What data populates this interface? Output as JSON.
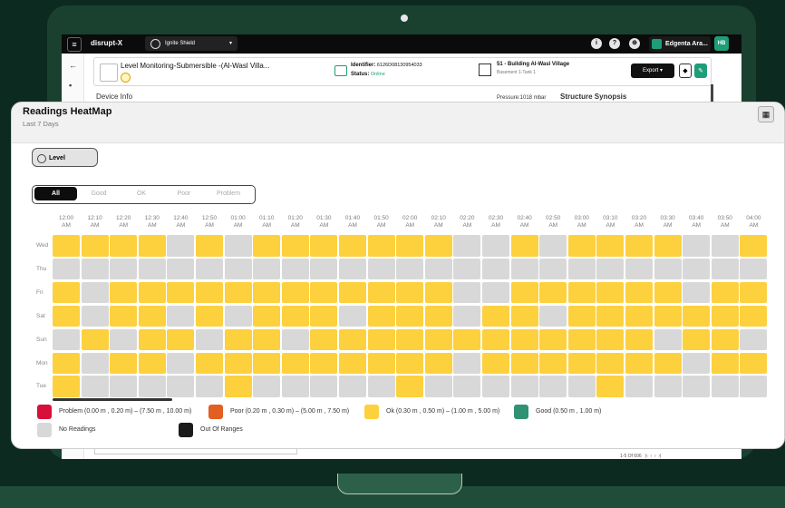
{
  "app": {
    "logo_text": "disrupt-X",
    "workspace": "Ignite Shield",
    "user": "Edgenta Ara...",
    "avatar": "HB",
    "top_icons": [
      "info-icon",
      "help-icon",
      "globe-icon"
    ]
  },
  "device": {
    "title": "Level Monitoring-Submersible -(Al-Wasl Villa...",
    "identifier_label": "Identifier:",
    "identifier": "6126D08130954033",
    "status_label": "Status:",
    "status": "Online",
    "building": "51 - Building Al-Wasl Village",
    "location": "Basement 1-Tank 1",
    "export_label": "Export"
  },
  "background_peek": {
    "device_info": "Device Info",
    "pressure": "Pressure:1018 mbar",
    "structure": "Structure Synopsis",
    "pager": "1-5 Of 606"
  },
  "heatmap": {
    "title": "Readings HeatMap",
    "subtitle": "Last 7 Days",
    "level_label": "Level",
    "filters": [
      "All",
      "Good",
      "OK",
      "Poor",
      "Problem"
    ],
    "active_filter": "All",
    "times": [
      "12:00 AM",
      "12:10 AM",
      "12:20 AM",
      "12:30 AM",
      "12:40 AM",
      "12:50 AM",
      "01:00 AM",
      "01:10 AM",
      "01:20 AM",
      "01:30 AM",
      "01:40 AM",
      "01:50 AM",
      "02:00 AM",
      "02:10 AM",
      "02:20 AM",
      "02:30 AM",
      "02:40 AM",
      "02:50 AM",
      "03:00 AM",
      "03:10 AM",
      "03:20 AM",
      "03:30 AM",
      "03:40 AM",
      "03:50 AM",
      "04:00 AM"
    ],
    "days": [
      "Wed",
      "Thu",
      "Fri",
      "Sat",
      "Sun",
      "Mon",
      "Tue"
    ],
    "status_colors": {
      "problem": "#d80f38",
      "poor": "#e35e22",
      "ok": "#fdd03d",
      "good": "#2e9273",
      "none": "#d8d8d8",
      "out_of_range": "#1b1b1b"
    },
    "grid": [
      [
        "ok",
        "ok",
        "ok",
        "ok",
        "none",
        "ok",
        "none",
        "ok",
        "ok",
        "ok",
        "ok",
        "ok",
        "ok",
        "ok",
        "none",
        "none",
        "ok",
        "none",
        "ok",
        "ok",
        "ok",
        "ok",
        "none",
        "none",
        "ok"
      ],
      [
        "none",
        "none",
        "none",
        "none",
        "none",
        "none",
        "none",
        "none",
        "none",
        "none",
        "none",
        "none",
        "none",
        "none",
        "none",
        "none",
        "none",
        "none",
        "none",
        "none",
        "none",
        "none",
        "none",
        "none",
        "none"
      ],
      [
        "ok",
        "none",
        "ok",
        "ok",
        "ok",
        "ok",
        "ok",
        "ok",
        "ok",
        "ok",
        "ok",
        "ok",
        "ok",
        "ok",
        "none",
        "none",
        "ok",
        "ok",
        "ok",
        "ok",
        "ok",
        "ok",
        "none",
        "ok",
        "ok"
      ],
      [
        "ok",
        "none",
        "ok",
        "ok",
        "none",
        "ok",
        "none",
        "ok",
        "ok",
        "ok",
        "none",
        "ok",
        "ok",
        "ok",
        "none",
        "ok",
        "ok",
        "none",
        "ok",
        "ok",
        "ok",
        "ok",
        "ok",
        "ok",
        "ok"
      ],
      [
        "none",
        "ok",
        "none",
        "ok",
        "ok",
        "none",
        "ok",
        "ok",
        "none",
        "ok",
        "ok",
        "ok",
        "ok",
        "ok",
        "ok",
        "ok",
        "ok",
        "ok",
        "ok",
        "ok",
        "ok",
        "none",
        "ok",
        "ok",
        "none"
      ],
      [
        "ok",
        "none",
        "ok",
        "ok",
        "none",
        "ok",
        "ok",
        "ok",
        "ok",
        "ok",
        "ok",
        "ok",
        "ok",
        "ok",
        "none",
        "ok",
        "ok",
        "ok",
        "ok",
        "ok",
        "ok",
        "ok",
        "none",
        "ok",
        "ok"
      ],
      [
        "ok",
        "none",
        "none",
        "none",
        "none",
        "none",
        "ok",
        "none",
        "none",
        "none",
        "none",
        "none",
        "ok",
        "none",
        "none",
        "none",
        "none",
        "none",
        "none",
        "ok",
        "none",
        "none",
        "none",
        "none",
        "none"
      ]
    ],
    "legend": [
      {
        "key": "problem",
        "label": "Problem (0.00 m , 0.20 m) – (7.50 m , 10.00 m)"
      },
      {
        "key": "poor",
        "label": "Poor (0.20 m , 0.30 m) – (5.00 m , 7.50 m)"
      },
      {
        "key": "ok",
        "label": "Ok (0.30 m , 0.50 m) – (1.00 m , 5.00 m)"
      },
      {
        "key": "good",
        "label": "Good (0.50 m , 1.00 m)"
      },
      {
        "key": "none",
        "label": "No Readings"
      },
      {
        "key": "out_of_range",
        "label": "Out Of Ranges"
      }
    ]
  }
}
